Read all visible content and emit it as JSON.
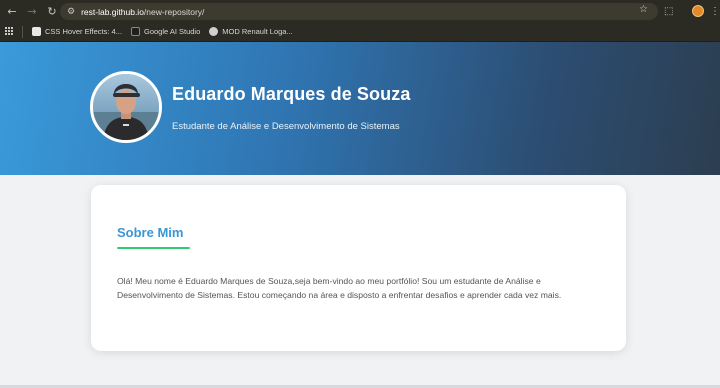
{
  "browser": {
    "url_host": "rest-lab.github.io",
    "url_path": "/new-repository/",
    "bookmarks": [
      {
        "label": "CSS Hover Effects: 4...",
        "color": "#e8e8e8"
      },
      {
        "label": "Google AI Studio",
        "color": "#1f1f1f"
      },
      {
        "label": "MOD Renault Loga...",
        "color": "#cfcfcf"
      }
    ]
  },
  "header": {
    "name": "Eduardo Marques de Souza",
    "role": "Estudante de Análise e Desenvolvimento de Sistemas"
  },
  "about": {
    "title": "Sobre Mim",
    "text": "Olá! Meu nome é Eduardo Marques de Souza,seja bem-vindo ao meu portfólio! Sou um estudante de Análise e Desenvolvimento de Sistemas. Estou começando na área e disposto a enfrentar desafios e aprender cada vez mais."
  },
  "colors": {
    "header_gradient_start": "#3a9adb",
    "header_gradient_end": "#2c3e50",
    "title_accent": "#3a97d4",
    "underline_accent": "#2ecc71"
  }
}
